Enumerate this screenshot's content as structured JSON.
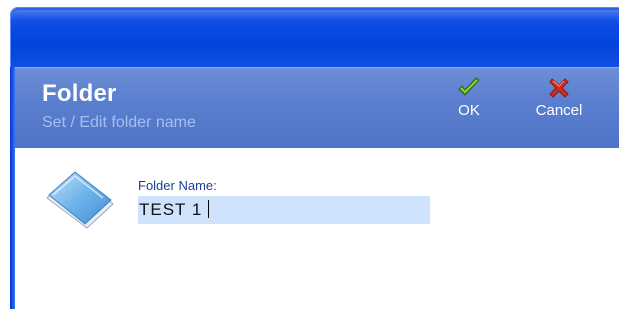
{
  "header": {
    "title": "Folder",
    "subtitle": "Set / Edit folder name"
  },
  "toolbar": {
    "ok": {
      "label": "OK",
      "icon": "checkmark-icon"
    },
    "cancel": {
      "label": "Cancel",
      "icon": "red-x-icon"
    }
  },
  "form": {
    "folder_name_label": "Folder Name:",
    "folder_name_value": "TEST 1"
  },
  "colors": {
    "titlebar": "#0a49e3",
    "header_band": "#5b7fcf",
    "input_background": "#cfe2fb",
    "label_text": "#1c3d9a",
    "ok_icon": "#4c9a1a",
    "cancel_icon": "#d22b1f"
  }
}
